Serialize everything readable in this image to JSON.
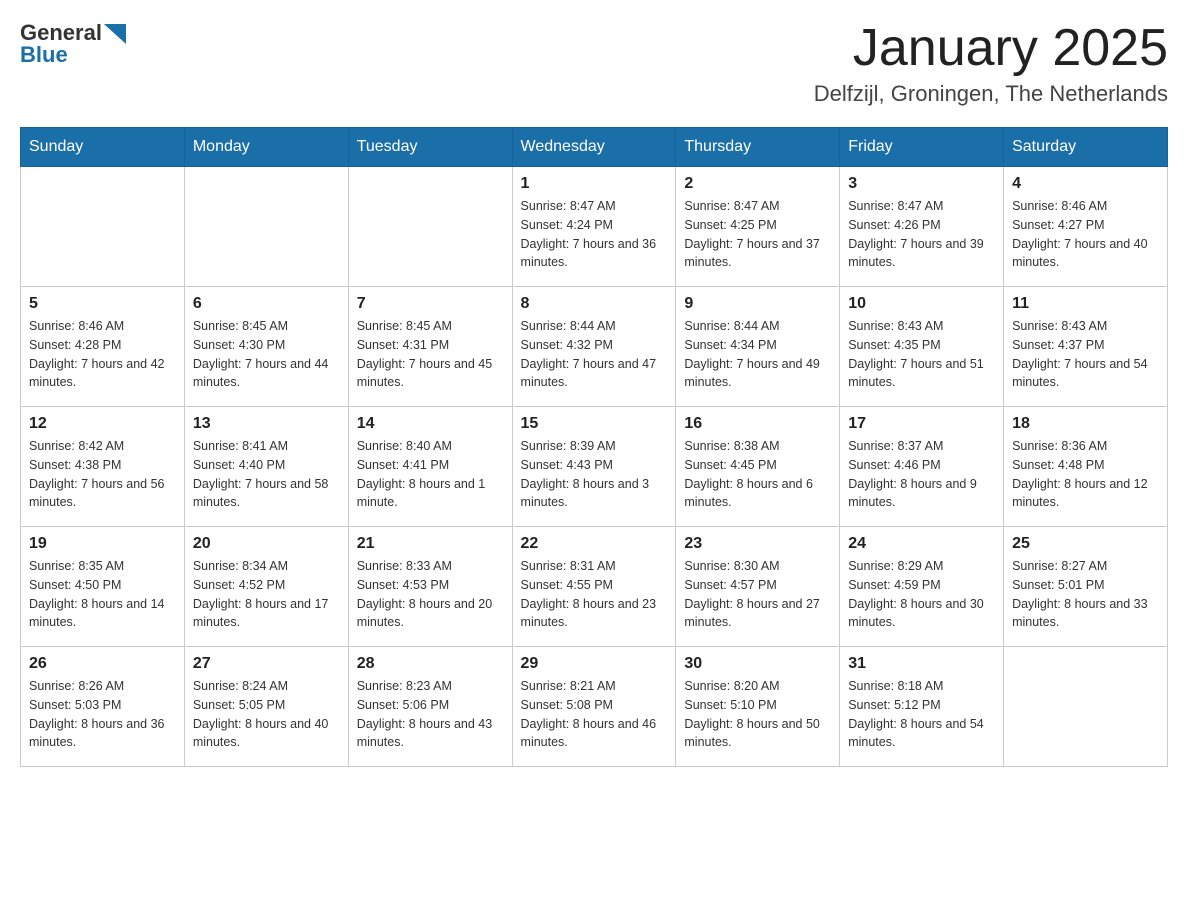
{
  "logo": {
    "text_general": "General",
    "text_blue": "Blue"
  },
  "title": "January 2025",
  "subtitle": "Delfzijl, Groningen, The Netherlands",
  "days_of_week": [
    "Sunday",
    "Monday",
    "Tuesday",
    "Wednesday",
    "Thursday",
    "Friday",
    "Saturday"
  ],
  "weeks": [
    [
      null,
      null,
      null,
      {
        "day": 1,
        "sunrise": "8:47 AM",
        "sunset": "4:24 PM",
        "daylight": "7 hours and 36 minutes."
      },
      {
        "day": 2,
        "sunrise": "8:47 AM",
        "sunset": "4:25 PM",
        "daylight": "7 hours and 37 minutes."
      },
      {
        "day": 3,
        "sunrise": "8:47 AM",
        "sunset": "4:26 PM",
        "daylight": "7 hours and 39 minutes."
      },
      {
        "day": 4,
        "sunrise": "8:46 AM",
        "sunset": "4:27 PM",
        "daylight": "7 hours and 40 minutes."
      }
    ],
    [
      {
        "day": 5,
        "sunrise": "8:46 AM",
        "sunset": "4:28 PM",
        "daylight": "7 hours and 42 minutes."
      },
      {
        "day": 6,
        "sunrise": "8:45 AM",
        "sunset": "4:30 PM",
        "daylight": "7 hours and 44 minutes."
      },
      {
        "day": 7,
        "sunrise": "8:45 AM",
        "sunset": "4:31 PM",
        "daylight": "7 hours and 45 minutes."
      },
      {
        "day": 8,
        "sunrise": "8:44 AM",
        "sunset": "4:32 PM",
        "daylight": "7 hours and 47 minutes."
      },
      {
        "day": 9,
        "sunrise": "8:44 AM",
        "sunset": "4:34 PM",
        "daylight": "7 hours and 49 minutes."
      },
      {
        "day": 10,
        "sunrise": "8:43 AM",
        "sunset": "4:35 PM",
        "daylight": "7 hours and 51 minutes."
      },
      {
        "day": 11,
        "sunrise": "8:43 AM",
        "sunset": "4:37 PM",
        "daylight": "7 hours and 54 minutes."
      }
    ],
    [
      {
        "day": 12,
        "sunrise": "8:42 AM",
        "sunset": "4:38 PM",
        "daylight": "7 hours and 56 minutes."
      },
      {
        "day": 13,
        "sunrise": "8:41 AM",
        "sunset": "4:40 PM",
        "daylight": "7 hours and 58 minutes."
      },
      {
        "day": 14,
        "sunrise": "8:40 AM",
        "sunset": "4:41 PM",
        "daylight": "8 hours and 1 minute."
      },
      {
        "day": 15,
        "sunrise": "8:39 AM",
        "sunset": "4:43 PM",
        "daylight": "8 hours and 3 minutes."
      },
      {
        "day": 16,
        "sunrise": "8:38 AM",
        "sunset": "4:45 PM",
        "daylight": "8 hours and 6 minutes."
      },
      {
        "day": 17,
        "sunrise": "8:37 AM",
        "sunset": "4:46 PM",
        "daylight": "8 hours and 9 minutes."
      },
      {
        "day": 18,
        "sunrise": "8:36 AM",
        "sunset": "4:48 PM",
        "daylight": "8 hours and 12 minutes."
      }
    ],
    [
      {
        "day": 19,
        "sunrise": "8:35 AM",
        "sunset": "4:50 PM",
        "daylight": "8 hours and 14 minutes."
      },
      {
        "day": 20,
        "sunrise": "8:34 AM",
        "sunset": "4:52 PM",
        "daylight": "8 hours and 17 minutes."
      },
      {
        "day": 21,
        "sunrise": "8:33 AM",
        "sunset": "4:53 PM",
        "daylight": "8 hours and 20 minutes."
      },
      {
        "day": 22,
        "sunrise": "8:31 AM",
        "sunset": "4:55 PM",
        "daylight": "8 hours and 23 minutes."
      },
      {
        "day": 23,
        "sunrise": "8:30 AM",
        "sunset": "4:57 PM",
        "daylight": "8 hours and 27 minutes."
      },
      {
        "day": 24,
        "sunrise": "8:29 AM",
        "sunset": "4:59 PM",
        "daylight": "8 hours and 30 minutes."
      },
      {
        "day": 25,
        "sunrise": "8:27 AM",
        "sunset": "5:01 PM",
        "daylight": "8 hours and 33 minutes."
      }
    ],
    [
      {
        "day": 26,
        "sunrise": "8:26 AM",
        "sunset": "5:03 PM",
        "daylight": "8 hours and 36 minutes."
      },
      {
        "day": 27,
        "sunrise": "8:24 AM",
        "sunset": "5:05 PM",
        "daylight": "8 hours and 40 minutes."
      },
      {
        "day": 28,
        "sunrise": "8:23 AM",
        "sunset": "5:06 PM",
        "daylight": "8 hours and 43 minutes."
      },
      {
        "day": 29,
        "sunrise": "8:21 AM",
        "sunset": "5:08 PM",
        "daylight": "8 hours and 46 minutes."
      },
      {
        "day": 30,
        "sunrise": "8:20 AM",
        "sunset": "5:10 PM",
        "daylight": "8 hours and 50 minutes."
      },
      {
        "day": 31,
        "sunrise": "8:18 AM",
        "sunset": "5:12 PM",
        "daylight": "8 hours and 54 minutes."
      },
      null
    ]
  ]
}
